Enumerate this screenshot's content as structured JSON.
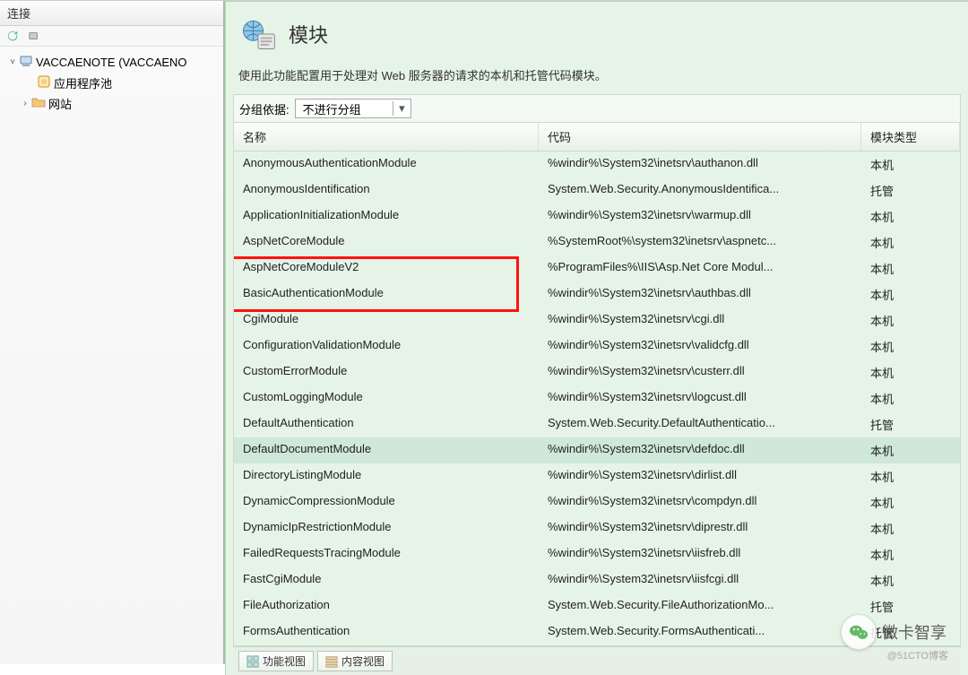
{
  "leftPanel": {
    "header": "连接",
    "tree": {
      "root": {
        "label": "VACCAENOTE (VACCAENO"
      },
      "items": [
        {
          "label": "应用程序池"
        },
        {
          "label": "网站"
        }
      ]
    }
  },
  "main": {
    "title": "模块",
    "description": "使用此功能配置用于处理对 Web 服务器的请求的本机和托管代码模块。",
    "groupLabel": "分组依据:",
    "groupValue": "不进行分组",
    "columns": {
      "name": "名称",
      "code": "代码",
      "type": "模块类型"
    },
    "selectedRowIndex": 11,
    "highlightRows": [
      3,
      4
    ],
    "rows": [
      {
        "name": "AnonymousAuthenticationModule",
        "code": "%windir%\\System32\\inetsrv\\authanon.dll",
        "type": "本机"
      },
      {
        "name": "AnonymousIdentification",
        "code": "System.Web.Security.AnonymousIdentifica...",
        "type": "托管"
      },
      {
        "name": "ApplicationInitializationModule",
        "code": "%windir%\\System32\\inetsrv\\warmup.dll",
        "type": "本机"
      },
      {
        "name": "AspNetCoreModule",
        "code": "%SystemRoot%\\system32\\inetsrv\\aspnetc...",
        "type": "本机"
      },
      {
        "name": "AspNetCoreModuleV2",
        "code": "%ProgramFiles%\\IIS\\Asp.Net Core Modul...",
        "type": "本机"
      },
      {
        "name": "BasicAuthenticationModule",
        "code": "%windir%\\System32\\inetsrv\\authbas.dll",
        "type": "本机"
      },
      {
        "name": "CgiModule",
        "code": "%windir%\\System32\\inetsrv\\cgi.dll",
        "type": "本机"
      },
      {
        "name": "ConfigurationValidationModule",
        "code": "%windir%\\System32\\inetsrv\\validcfg.dll",
        "type": "本机"
      },
      {
        "name": "CustomErrorModule",
        "code": "%windir%\\System32\\inetsrv\\custerr.dll",
        "type": "本机"
      },
      {
        "name": "CustomLoggingModule",
        "code": "%windir%\\System32\\inetsrv\\logcust.dll",
        "type": "本机"
      },
      {
        "name": "DefaultAuthentication",
        "code": "System.Web.Security.DefaultAuthenticatio...",
        "type": "托管"
      },
      {
        "name": "DefaultDocumentModule",
        "code": "%windir%\\System32\\inetsrv\\defdoc.dll",
        "type": "本机"
      },
      {
        "name": "DirectoryListingModule",
        "code": "%windir%\\System32\\inetsrv\\dirlist.dll",
        "type": "本机"
      },
      {
        "name": "DynamicCompressionModule",
        "code": "%windir%\\System32\\inetsrv\\compdyn.dll",
        "type": "本机"
      },
      {
        "name": "DynamicIpRestrictionModule",
        "code": "%windir%\\System32\\inetsrv\\diprestr.dll",
        "type": "本机"
      },
      {
        "name": "FailedRequestsTracingModule",
        "code": "%windir%\\System32\\inetsrv\\iisfreb.dll",
        "type": "本机"
      },
      {
        "name": "FastCgiModule",
        "code": "%windir%\\System32\\inetsrv\\iisfcgi.dll",
        "type": "本机"
      },
      {
        "name": "FileAuthorization",
        "code": "System.Web.Security.FileAuthorizationMo...",
        "type": "托管"
      },
      {
        "name": "FormsAuthentication",
        "code": "System.Web.Security.FormsAuthenticati...",
        "type": "托管"
      }
    ],
    "bottomTabs": {
      "features": "功能视图",
      "content": "内容视图"
    }
  },
  "watermark": {
    "text": "微卡智享",
    "sub": "@51CTO博客"
  }
}
